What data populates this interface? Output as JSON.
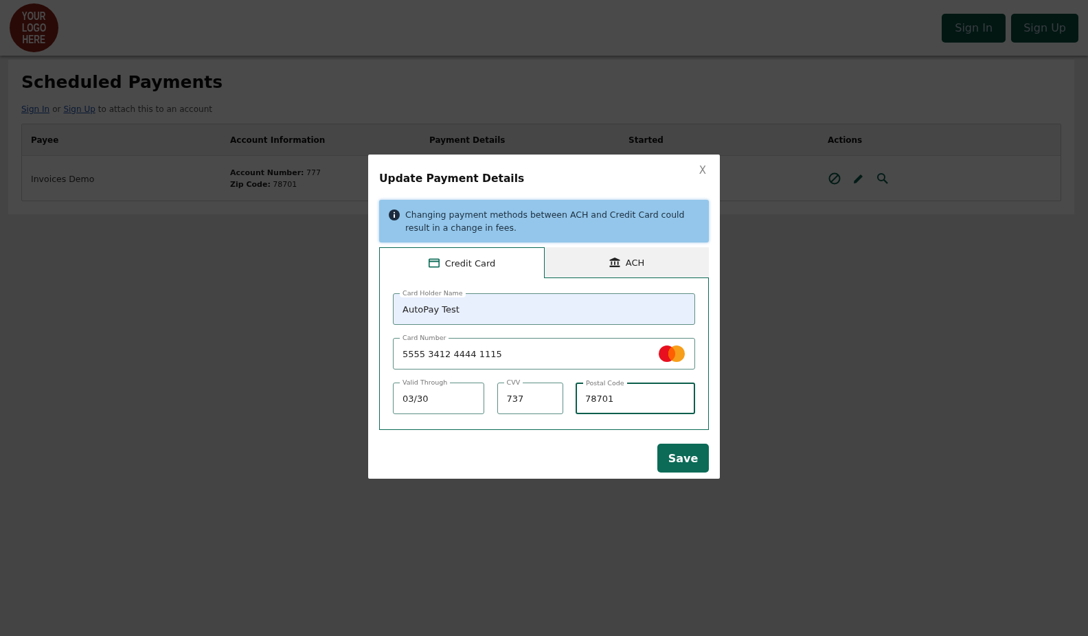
{
  "header": {
    "logo": [
      "YOUR",
      "LOGO",
      "HERE"
    ],
    "buttons": [
      "Sign In",
      "Sign Up"
    ]
  },
  "page": {
    "title": "Scheduled Payments",
    "prompt": {
      "links": [
        "Sign In",
        "Sign Up"
      ],
      "joiner": "or",
      "rest": "to attach this to an account"
    }
  },
  "table": {
    "columns": [
      "Payee",
      "Account Information",
      "Payment Details",
      "Started",
      "Actions"
    ],
    "rows": [
      {
        "payee": "Invoices Demo",
        "account": [
          {
            "label": "Account Number:",
            "value": "777"
          },
          {
            "label": "Zip Code:",
            "value": "78701"
          }
        ],
        "actions": [
          {
            "kind": "disable"
          },
          {
            "kind": "edit"
          },
          {
            "kind": "view"
          }
        ]
      }
    ]
  },
  "modal": {
    "title": "Update Payment Details",
    "close": "X",
    "alert": "Changing payment methods between ACH and Credit Card could result in a change in fees.",
    "tabs": [
      {
        "label": "Credit Card",
        "kind": "card",
        "selected": true
      },
      {
        "label": "ACH",
        "kind": "bank",
        "selected": false
      }
    ],
    "fields": [
      {
        "label": "Card Holder Name",
        "value": "AutoPay Test",
        "autofilled": true,
        "focused": false,
        "kind": "text"
      },
      {
        "label": "Card Number",
        "value": "5555 3412 4444 1115",
        "autofilled": false,
        "focused": false,
        "kind": "card_number"
      },
      {
        "label": "Valid Through",
        "value": "03/30",
        "autofilled": false,
        "focused": false,
        "kind": "text"
      },
      {
        "label": "CVV",
        "value": "737",
        "autofilled": false,
        "focused": false,
        "kind": "text"
      },
      {
        "label": "Postal Code",
        "value": "78701",
        "autofilled": false,
        "focused": true,
        "kind": "text"
      }
    ],
    "save": "Save"
  }
}
